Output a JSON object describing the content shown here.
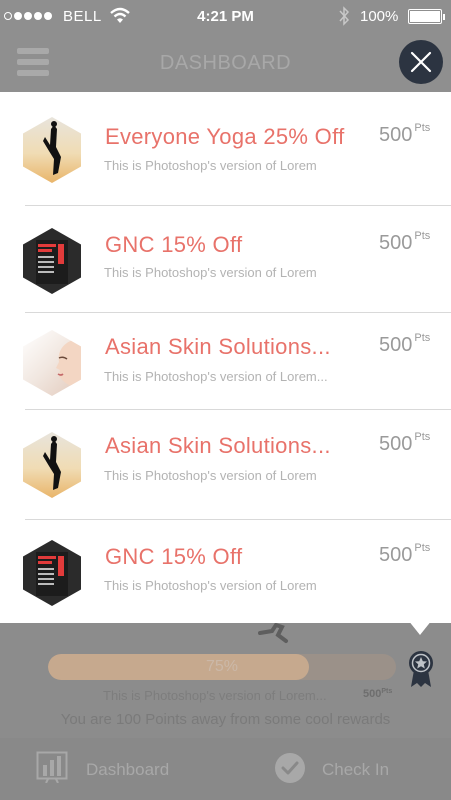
{
  "status_bar": {
    "carrier": "BELL",
    "time": "4:21 PM",
    "battery": "100%"
  },
  "header": {
    "title": "DASHBOARD"
  },
  "rewards": [
    {
      "name": "Everyone Yoga 25% Off",
      "description": "This is Photoshop's version  of Lorem",
      "points": "500",
      "points_unit": "Pts",
      "image": "yoga-image"
    },
    {
      "name": "GNC 15% Off",
      "description": "This is Photoshop's version  of Lorem",
      "points": "500",
      "points_unit": "Pts",
      "image": "gnc-image"
    },
    {
      "name": "Asian Skin Solutions...",
      "description": "This is Photoshop's version  of Lorem...",
      "points": "500",
      "points_unit": "Pts",
      "image": "skin-image"
    },
    {
      "name": "Asian Skin Solutions...",
      "description": "This is Photoshop's version  of Lorem",
      "points": "500",
      "points_unit": "Pts",
      "image": "yoga-image"
    },
    {
      "name": "GNC 15% Off",
      "description": "This is Photoshop's version  of Lorem",
      "points": "500",
      "points_unit": "Pts",
      "image": "gnc-image"
    }
  ],
  "progress": {
    "label": "75%",
    "fraction": 0.75,
    "description": "This is Photoshop's version  of Lorem...",
    "points": "500",
    "points_unit": "Pts",
    "message": "You are 100 Points away from some cool rewards"
  },
  "bottom_nav": {
    "dashboard": "Dashboard",
    "check_in": "Check In"
  },
  "colors": {
    "accent": "#e8726a",
    "close_button": "#2c3441",
    "overlay": "#8c8c8c"
  }
}
